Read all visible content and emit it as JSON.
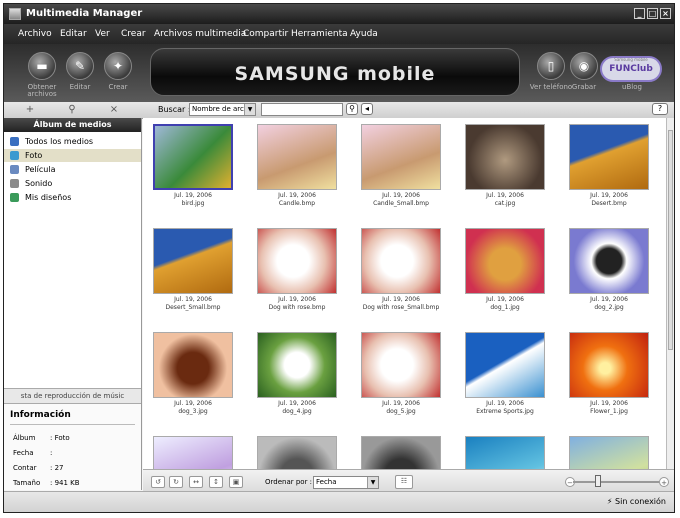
{
  "window": {
    "title": "Multimedia Manager"
  },
  "menu": [
    "Archivo",
    "Editar",
    "Ver",
    "Crear",
    "Archivos multimedia",
    "Compartir",
    "Herramienta",
    "Ayuda"
  ],
  "toolbar": {
    "obtener": "Obtener archivos",
    "editar": "Editar",
    "crear": "Crear",
    "ver": "Ver teléfono",
    "grabar": "Grabar",
    "ublog": "uBlog",
    "banner": "SAMSUNG mobile",
    "funclub_top": "Samsung mobile",
    "funclub": "FUNClub"
  },
  "search": {
    "label": "Buscar :",
    "field": "Nombre de archi",
    "value": ""
  },
  "sidebar": {
    "header": "Álbum de medios",
    "items": [
      "Todos los medios",
      "Foto",
      "Película",
      "Sonido",
      "Mis diseños"
    ],
    "playlist": "sta de reproducción de músic"
  },
  "info": {
    "header": "Información",
    "rows": [
      {
        "label": "Álbum",
        "value": ": Foto"
      },
      {
        "label": "Fecha",
        "value": ":"
      },
      {
        "label": "Contar",
        "value": ": 27"
      },
      {
        "label": "Tamaño",
        "value": ": 941 KB"
      }
    ]
  },
  "items": [
    {
      "date": "Jul. 19, 2006",
      "name": "bird.jpg"
    },
    {
      "date": "Jul. 19, 2006",
      "name": "Candle.bmp"
    },
    {
      "date": "Jul. 19, 2006",
      "name": "Candle_Small.bmp"
    },
    {
      "date": "Jul. 19, 2006",
      "name": "cat.jpg"
    },
    {
      "date": "Jul. 19, 2006",
      "name": "Desert.bmp"
    },
    {
      "date": "Jul. 19, 2006",
      "name": "Desert_Small.bmp"
    },
    {
      "date": "Jul. 19, 2006",
      "name": "Dog with rose.bmp"
    },
    {
      "date": "Jul. 19, 2006",
      "name": "Dog with rose_Small.bmp"
    },
    {
      "date": "Jul. 19, 2006",
      "name": "dog_1.jpg"
    },
    {
      "date": "Jul. 19, 2006",
      "name": "dog_2.jpg"
    },
    {
      "date": "Jul. 19, 2006",
      "name": "dog_3.jpg"
    },
    {
      "date": "Jul. 19, 2006",
      "name": "dog_4.jpg"
    },
    {
      "date": "Jul. 19, 2006",
      "name": "dog_5.jpg"
    },
    {
      "date": "Jul. 19, 2006",
      "name": "Extreme Sports.jpg"
    },
    {
      "date": "Jul. 19, 2006",
      "name": "Flower_1.jpg"
    },
    {
      "date": "",
      "name": ""
    },
    {
      "date": "",
      "name": ""
    },
    {
      "date": "",
      "name": ""
    },
    {
      "date": "",
      "name": ""
    },
    {
      "date": "",
      "name": ""
    }
  ],
  "bottom": {
    "sort_label": "Ordenar por :",
    "sort_value": "Fecha"
  },
  "status": {
    "text": "Sin conexión"
  }
}
